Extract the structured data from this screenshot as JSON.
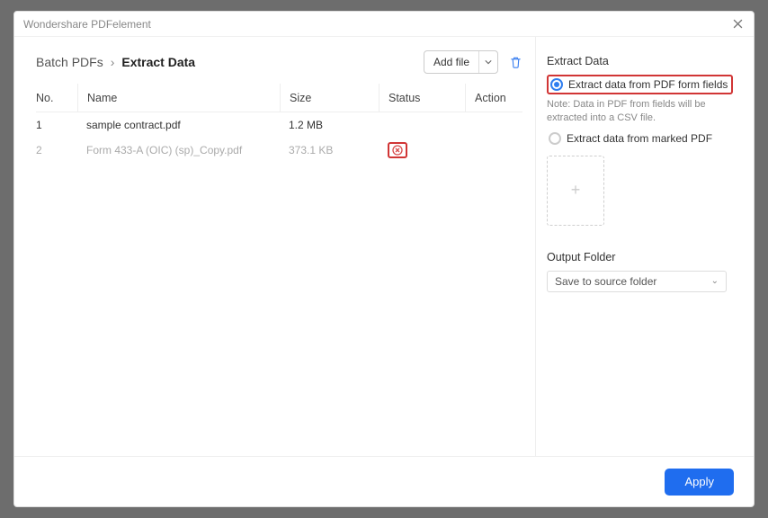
{
  "app_title": "Wondershare PDFelement",
  "breadcrumb": {
    "parent": "Batch PDFs",
    "current": "Extract Data"
  },
  "toolbar": {
    "add_file_label": "Add file"
  },
  "columns": {
    "no": "No.",
    "name": "Name",
    "size": "Size",
    "status": "Status",
    "action": "Action"
  },
  "rows": [
    {
      "no": "1",
      "name": "sample contract.pdf",
      "size": "1.2 MB",
      "dim": false,
      "remove": false
    },
    {
      "no": "2",
      "name": "Form 433-A (OIC) (sp)_Copy.pdf",
      "size": "373.1 KB",
      "dim": true,
      "remove": true
    }
  ],
  "panel": {
    "title": "Extract Data",
    "option_form_fields": "Extract data from PDF form fields",
    "note": "Note: Data in PDF from fields will be extracted into a CSV file.",
    "option_marked": "Extract data from marked PDF",
    "output_folder_label": "Output Folder",
    "output_folder_value": "Save to source folder"
  },
  "footer": {
    "apply_label": "Apply"
  }
}
